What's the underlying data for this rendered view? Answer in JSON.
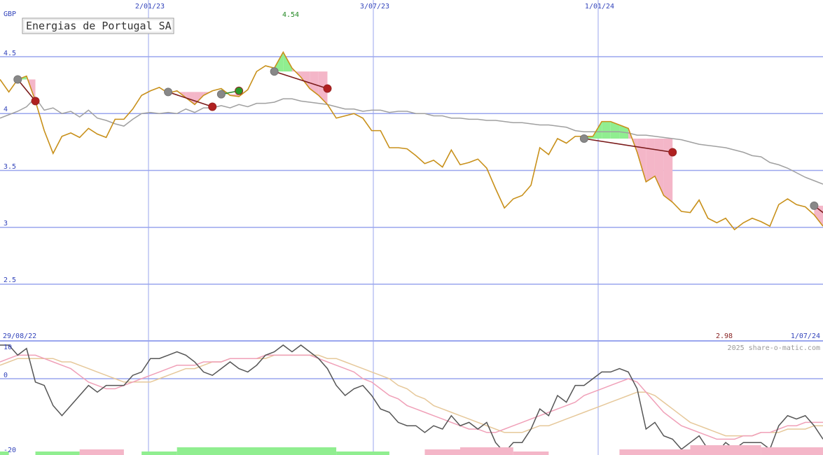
{
  "chart_data": {
    "type": "line",
    "title": "Energias de Portugal SA",
    "currency": "GBP",
    "watermark": "2025 share-o-matic.com",
    "date_range_start": "29/08/22",
    "date_range_end": "1/07/24",
    "x_tick_labels": [
      "2/01/23",
      "3/07/23",
      "1/01/24"
    ],
    "y_tick_labels": [
      "4.5",
      "4",
      "3.5",
      "3",
      "2.5"
    ],
    "y_ticks": [
      4.5,
      4.0,
      3.5,
      3.0,
      2.5
    ],
    "ylim": [
      2.5,
      4.75
    ],
    "high_label": "4.54",
    "low_label": "2.98",
    "oscillator_tick_labels": [
      "10",
      "0",
      "-20"
    ],
    "oscillator_ticks": [
      10,
      0,
      -20
    ],
    "oscillator_ylim": [
      -20,
      10
    ],
    "colors": {
      "price": "#c8901a",
      "moving_average": "#a0a0a0",
      "grid": "#9aa6ee",
      "axis_text": "#3344bb",
      "high_text": "#228822",
      "low_text": "#882222",
      "gain_fill": "#90ee90",
      "loss_fill": "#f4b6c8",
      "oscillator_main": "#555555",
      "oscillator_fast": "#f0a0b8",
      "oscillator_slow": "#e6c89a"
    },
    "series": [
      {
        "role": "price",
        "values": [
          4.3,
          4.19,
          4.3,
          4.33,
          4.11,
          3.85,
          3.65,
          3.8,
          3.83,
          3.79,
          3.87,
          3.82,
          3.79,
          3.95,
          3.95,
          4.04,
          4.16,
          4.2,
          4.23,
          4.18,
          4.2,
          4.14,
          4.08,
          4.16,
          4.2,
          4.22,
          4.16,
          4.15,
          4.21,
          4.37,
          4.42,
          4.4,
          4.54,
          4.4,
          4.32,
          4.22,
          4.16,
          4.08,
          3.96,
          3.98,
          4.0,
          3.96,
          3.85,
          3.85,
          3.7,
          3.7,
          3.69,
          3.63,
          3.56,
          3.59,
          3.53,
          3.68,
          3.55,
          3.57,
          3.6,
          3.52,
          3.34,
          3.17,
          3.25,
          3.28,
          3.37,
          3.7,
          3.64,
          3.78,
          3.74,
          3.8,
          3.8,
          3.8,
          3.93,
          3.93,
          3.9,
          3.87,
          3.66,
          3.4,
          3.45,
          3.28,
          3.22,
          3.14,
          3.13,
          3.24,
          3.08,
          3.04,
          3.08,
          2.98,
          3.04,
          3.08,
          3.05,
          3.01,
          3.2,
          3.25,
          3.2,
          3.18,
          3.11,
          3.01
        ]
      },
      {
        "role": "moving_average",
        "values": [
          3.96,
          3.99,
          4.02,
          4.06,
          4.14,
          4.03,
          4.05,
          4.0,
          4.02,
          3.97,
          4.03,
          3.96,
          3.94,
          3.91,
          3.89,
          3.95,
          4.0,
          4.01,
          4.0,
          4.01,
          4.0,
          4.04,
          4.01,
          4.05,
          4.05,
          4.07,
          4.05,
          4.08,
          4.06,
          4.09,
          4.09,
          4.1,
          4.13,
          4.13,
          4.11,
          4.1,
          4.09,
          4.08,
          4.06,
          4.04,
          4.04,
          4.02,
          4.03,
          4.03,
          4.01,
          4.02,
          4.02,
          4.0,
          4.0,
          3.98,
          3.98,
          3.96,
          3.96,
          3.95,
          3.95,
          3.94,
          3.94,
          3.93,
          3.92,
          3.92,
          3.91,
          3.9,
          3.9,
          3.89,
          3.88,
          3.85,
          3.84,
          3.84,
          3.84,
          3.84,
          3.84,
          3.83,
          3.81,
          3.81,
          3.8,
          3.79,
          3.78,
          3.77,
          3.75,
          3.73,
          3.72,
          3.71,
          3.7,
          3.68,
          3.66,
          3.63,
          3.62,
          3.57,
          3.55,
          3.52,
          3.48,
          3.44,
          3.41,
          3.38
        ]
      }
    ],
    "trades": [
      {
        "entry_index": 2,
        "entry": 4.3,
        "exit_index": 4,
        "exit": 4.11,
        "result": "loss"
      },
      {
        "entry_index": 19,
        "entry": 4.19,
        "exit_index": 24,
        "exit": 4.06,
        "result": "loss"
      },
      {
        "entry_index": 25,
        "entry": 4.17,
        "exit_index": 27,
        "exit": 4.2,
        "result": "gain"
      },
      {
        "entry_index": 31,
        "entry": 4.37,
        "exit_index": 37,
        "exit": 4.22,
        "result": "loss"
      },
      {
        "entry_index": 66,
        "entry": 3.78,
        "exit_index": 76,
        "exit": 3.66,
        "result": "loss"
      },
      {
        "entry_index": 92,
        "entry": 3.19,
        "exit_index": 95,
        "exit": 3.01,
        "result": "open"
      }
    ],
    "oscillator_series": [
      {
        "role": "main",
        "values": [
          10,
          10,
          7,
          9,
          -1,
          -2,
          -8,
          -11,
          -8,
          -5,
          -2,
          -4,
          -2,
          -2,
          -2,
          1,
          2,
          6,
          6,
          7,
          8,
          7,
          5,
          2,
          1,
          3,
          5,
          3,
          2,
          4,
          7,
          8,
          10,
          8,
          10,
          8,
          6,
          3,
          -2,
          -5,
          -3,
          -2,
          -5,
          -9,
          -10,
          -13,
          -14,
          -14,
          -16,
          -14,
          -15,
          -11,
          -14,
          -13,
          -15,
          -13,
          -19,
          -22,
          -19,
          -19,
          -15,
          -9,
          -11,
          -5,
          -7,
          -2,
          -2,
          0,
          2,
          2,
          3,
          2,
          -3,
          -15,
          -13,
          -17,
          -18,
          -21,
          -19,
          -17,
          -21,
          -22,
          -19,
          -21,
          -19,
          -19,
          -19,
          -21,
          -14,
          -11,
          -12,
          -11,
          -14,
          -18
        ]
      },
      {
        "role": "fast",
        "values": [
          5,
          6,
          7,
          7,
          7,
          6,
          5,
          4,
          3,
          1,
          -1,
          -2,
          -3,
          -3,
          -2,
          -1,
          0,
          1,
          2,
          3,
          4,
          4,
          4,
          5,
          5,
          5,
          6,
          6,
          6,
          6,
          7,
          7,
          7,
          7,
          7,
          7,
          6,
          5,
          4,
          3,
          2,
          0,
          -1,
          -3,
          -5,
          -6,
          -8,
          -9,
          -10,
          -11,
          -12,
          -13,
          -14,
          -15,
          -15,
          -16,
          -16,
          -15,
          -14,
          -13,
          -12,
          -11,
          -10,
          -9,
          -8,
          -7,
          -5,
          -4,
          -3,
          -2,
          -1,
          0,
          -1,
          -4,
          -7,
          -10,
          -12,
          -14,
          -15,
          -16,
          -17,
          -18,
          -18,
          -18,
          -17,
          -17,
          -16,
          -16,
          -15,
          -14,
          -14,
          -13,
          -13,
          -13
        ]
      },
      {
        "role": "slow",
        "values": [
          4,
          5,
          6,
          6,
          6,
          6,
          6,
          5,
          5,
          4,
          3,
          2,
          1,
          0,
          -1,
          -1,
          -1,
          -1,
          0,
          1,
          2,
          3,
          3,
          4,
          5,
          5,
          6,
          6,
          6,
          6,
          6,
          7,
          7,
          7,
          7,
          7,
          7,
          6,
          6,
          5,
          4,
          3,
          2,
          1,
          0,
          -2,
          -3,
          -5,
          -6,
          -8,
          -9,
          -10,
          -11,
          -12,
          -13,
          -14,
          -15,
          -16,
          -16,
          -16,
          -15,
          -14,
          -14,
          -13,
          -12,
          -11,
          -10,
          -9,
          -8,
          -7,
          -6,
          -5,
          -4,
          -4,
          -5,
          -7,
          -9,
          -11,
          -13,
          -14,
          -15,
          -16,
          -17,
          -17,
          -17,
          -17,
          -16,
          -16,
          -16,
          -15,
          -15,
          -15,
          -14,
          -14
        ]
      }
    ],
    "volume_bars": [
      {
        "from_index": 0,
        "to_index": 1,
        "level": 1,
        "color": "gain"
      },
      {
        "from_index": 4,
        "to_index": 9,
        "level": 1,
        "color": "gain"
      },
      {
        "from_index": 9,
        "to_index": 14,
        "level": 2,
        "color": "loss"
      },
      {
        "from_index": 16,
        "to_index": 20,
        "level": 1,
        "color": "gain"
      },
      {
        "from_index": 20,
        "to_index": 38,
        "level": 3,
        "color": "gain"
      },
      {
        "from_index": 38,
        "to_index": 44,
        "level": 1,
        "color": "gain"
      },
      {
        "from_index": 48,
        "to_index": 52,
        "level": 2,
        "color": "loss"
      },
      {
        "from_index": 52,
        "to_index": 58,
        "level": 3,
        "color": "loss"
      },
      {
        "from_index": 58,
        "to_index": 62,
        "level": 1,
        "color": "loss"
      },
      {
        "from_index": 70,
        "to_index": 78,
        "level": 2,
        "color": "loss"
      },
      {
        "from_index": 78,
        "to_index": 86,
        "level": 4,
        "color": "loss"
      },
      {
        "from_index": 86,
        "to_index": 93,
        "level": 3,
        "color": "loss"
      }
    ]
  }
}
